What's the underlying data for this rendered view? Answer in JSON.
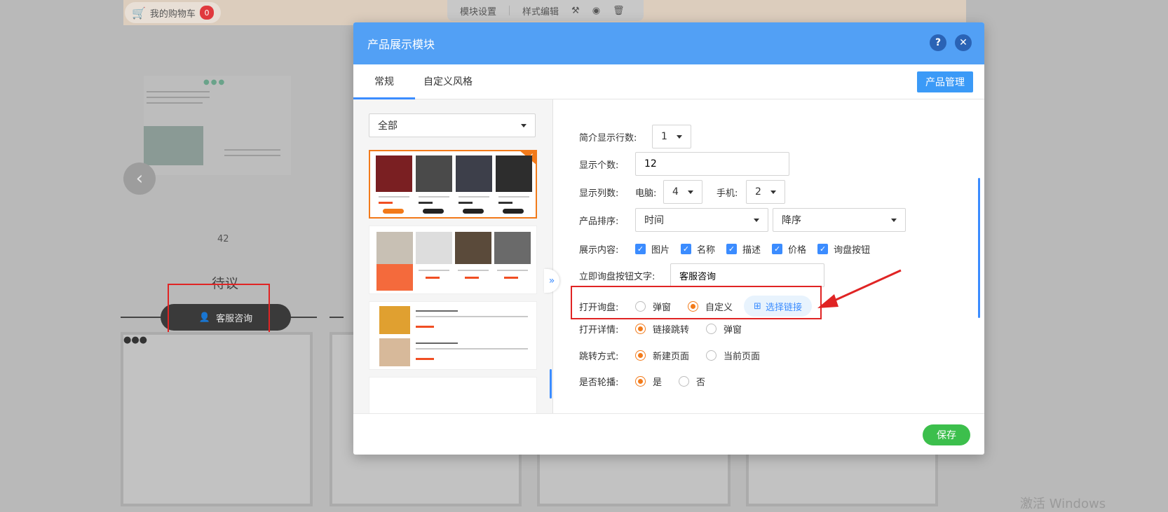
{
  "background": {
    "cart_label": "我的购物车",
    "cart_count": "0",
    "toolbar": {
      "module_settings": "模块设置",
      "style_edit": "样式编辑"
    },
    "prev_icon": "chevron-left-icon",
    "number": "42",
    "waiting_text": "待议",
    "consult_button": "客服咨询",
    "watermark": "激活 Windows"
  },
  "modal": {
    "title": "产品展示模块",
    "help_icon": "?",
    "close_icon": "✕",
    "tabs": [
      {
        "label": "常规",
        "active": true
      },
      {
        "label": "自定义风格",
        "active": false
      }
    ],
    "product_manage_button": "产品管理",
    "category_select": {
      "value": "全部"
    },
    "collapse_icon": "»",
    "settings": {
      "intro_lines": {
        "label": "简介显示行数:",
        "value": "1"
      },
      "display_count": {
        "label": "显示个数:",
        "value": "12"
      },
      "columns": {
        "label": "显示列数:",
        "pc_label": "电脑:",
        "pc_value": "4",
        "mobile_label": "手机:",
        "mobile_value": "2"
      },
      "sort": {
        "label": "产品排序:",
        "field": "时间",
        "order": "降序"
      },
      "content": {
        "label": "展示内容:",
        "options": [
          "图片",
          "名称",
          "描述",
          "价格",
          "询盘按钮"
        ]
      },
      "inquiry_text": {
        "label": "立即询盘按钮文字:",
        "value": "客服咨询"
      },
      "open_inquiry": {
        "label": "打开询盘:",
        "opt1": "弹窗",
        "opt2": "自定义",
        "link_button": "选择链接"
      },
      "open_detail": {
        "label": "打开详情:",
        "opt1": "链接跳转",
        "opt2": "弹窗"
      },
      "jump_mode": {
        "label": "跳转方式:",
        "opt1": "新建页面",
        "opt2": "当前页面"
      },
      "carousel": {
        "label": "是否轮播:",
        "opt1": "是",
        "opt2": "否"
      }
    },
    "save_button": "保存"
  },
  "colors": {
    "header": "#52a0f5",
    "accent": "#3b8cff",
    "orange": "#f27a1a",
    "save": "#3cbf4c",
    "annotation": "#e02424"
  }
}
